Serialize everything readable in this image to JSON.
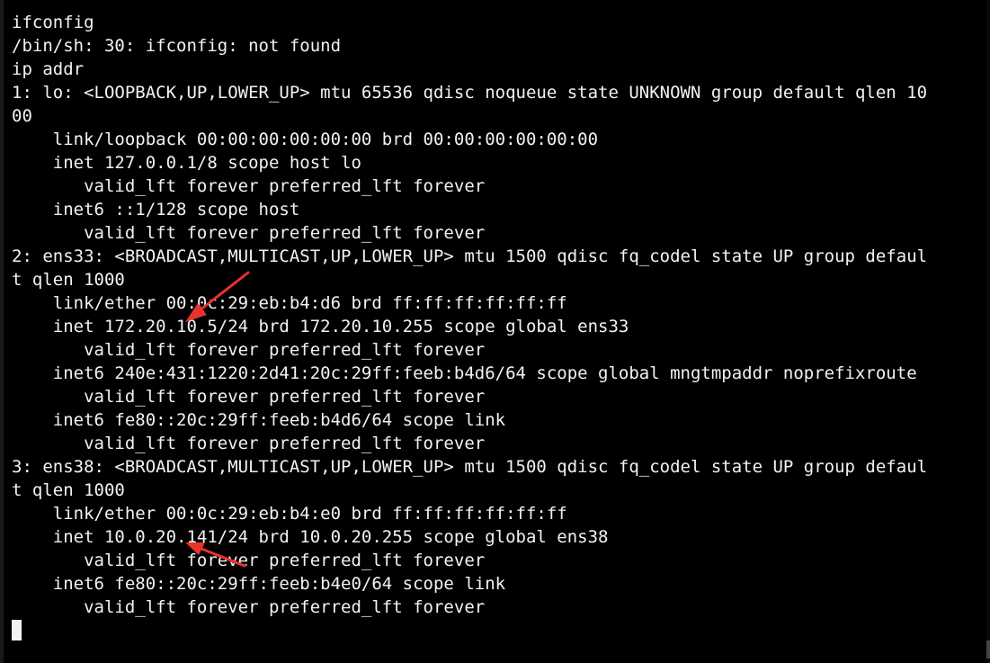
{
  "terminal": {
    "lines": [
      "ifconfig",
      "/bin/sh: 30: ifconfig: not found",
      "ip addr",
      "1: lo: <LOOPBACK,UP,LOWER_UP> mtu 65536 qdisc noqueue state UNKNOWN group default qlen 10",
      "00",
      "    link/loopback 00:00:00:00:00:00 brd 00:00:00:00:00:00",
      "    inet 127.0.0.1/8 scope host lo",
      "       valid_lft forever preferred_lft forever",
      "    inet6 ::1/128 scope host",
      "       valid_lft forever preferred_lft forever",
      "2: ens33: <BROADCAST,MULTICAST,UP,LOWER_UP> mtu 1500 qdisc fq_codel state UP group defaul",
      "t qlen 1000",
      "    link/ether 00:0c:29:eb:b4:d6 brd ff:ff:ff:ff:ff:ff",
      "    inet 172.20.10.5/24 brd 172.20.10.255 scope global ens33",
      "       valid_lft forever preferred_lft forever",
      "    inet6 240e:431:1220:2d41:20c:29ff:feeb:b4d6/64 scope global mngtmpaddr noprefixroute",
      "       valid_lft forever preferred_lft forever",
      "    inet6 fe80::20c:29ff:feeb:b4d6/64 scope link",
      "       valid_lft forever preferred_lft forever",
      "3: ens38: <BROADCAST,MULTICAST,UP,LOWER_UP> mtu 1500 qdisc fq_codel state UP group defaul",
      "t qlen 1000",
      "    link/ether 00:0c:29:eb:b4:e0 brd ff:ff:ff:ff:ff:ff",
      "    inet 10.0.20.141/24 brd 10.0.20.255 scope global ens38",
      "       valid_lft forever preferred_lft forever",
      "    inet6 fe80::20c:29ff:feeb:b4e0/64 scope link",
      "       valid_lft forever preferred_lft forever"
    ]
  },
  "colors": {
    "background": "#000000",
    "foreground": "#f2f2f2",
    "annotation_arrow": "#e8322e"
  }
}
